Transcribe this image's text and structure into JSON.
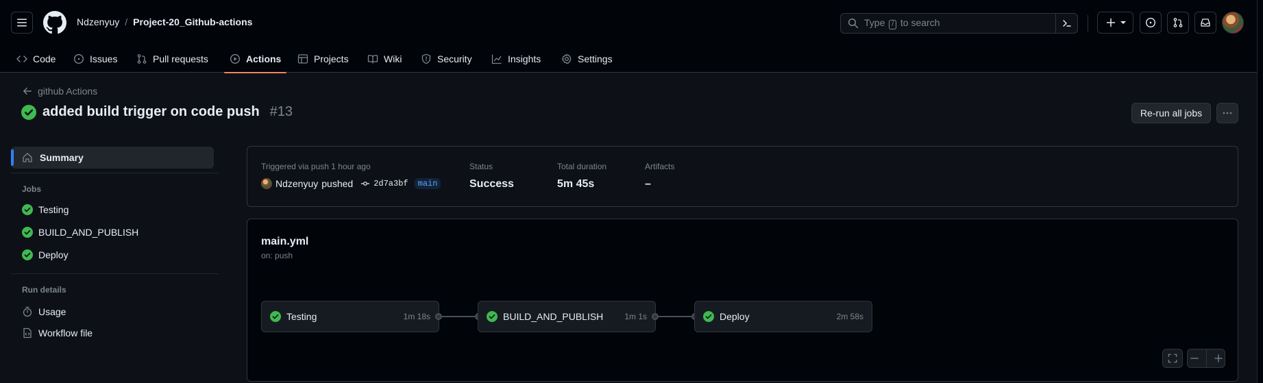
{
  "header": {
    "owner": "Ndzenyuy",
    "separator": "/",
    "repo": "Project-20_Github-actions",
    "search_prefix": "Type",
    "search_key": "/",
    "search_suffix": "to search"
  },
  "repo_nav": {
    "items": [
      {
        "label": "Code",
        "icon": "code-icon"
      },
      {
        "label": "Issues",
        "icon": "issue-icon"
      },
      {
        "label": "Pull requests",
        "icon": "pull-request-icon"
      },
      {
        "label": "Actions",
        "icon": "play-icon",
        "active": true
      },
      {
        "label": "Projects",
        "icon": "table-icon"
      },
      {
        "label": "Wiki",
        "icon": "book-icon"
      },
      {
        "label": "Security",
        "icon": "shield-icon"
      },
      {
        "label": "Insights",
        "icon": "graph-icon"
      },
      {
        "label": "Settings",
        "icon": "gear-icon"
      }
    ]
  },
  "page": {
    "back_label": "github Actions",
    "run_title": "added build trigger on code push",
    "run_number": "#13",
    "rerun_label": "Re-run all jobs"
  },
  "sidebar": {
    "summary_label": "Summary",
    "jobs_heading": "Jobs",
    "jobs": [
      {
        "label": "Testing",
        "status": "success"
      },
      {
        "label": "BUILD_AND_PUBLISH",
        "status": "success"
      },
      {
        "label": "Deploy",
        "status": "success"
      }
    ],
    "run_details_heading": "Run details",
    "usage_label": "Usage",
    "workflow_file_label": "Workflow file"
  },
  "summary": {
    "trigger_text": "Triggered via push 1 hour ago",
    "actor": "Ndzenyuy",
    "action": "pushed",
    "commit_sha": "2d7a3bf",
    "branch": "main",
    "status_label": "Status",
    "status_value": "Success",
    "duration_label": "Total duration",
    "duration_value": "5m 45s",
    "artifacts_label": "Artifacts",
    "artifacts_value": "–"
  },
  "graph": {
    "workflow_file": "main.yml",
    "trigger": "on: push",
    "jobs": [
      {
        "name": "Testing",
        "duration": "1m 18s"
      },
      {
        "name": "BUILD_AND_PUBLISH",
        "duration": "1m 1s"
      },
      {
        "name": "Deploy",
        "duration": "2m 58s"
      }
    ]
  },
  "colors": {
    "success": "#3fb950",
    "accent_underline": "#f78166",
    "link_blue": "#58a6ff"
  }
}
